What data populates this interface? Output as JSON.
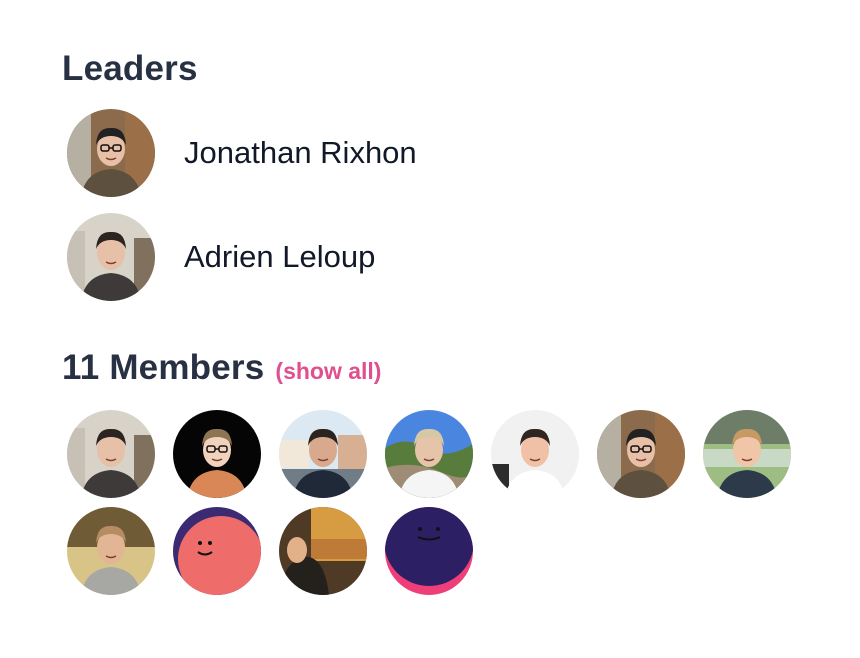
{
  "leaders": {
    "title": "Leaders",
    "people": [
      {
        "name": "Jonathan Rixhon",
        "avatar": "photo-glasses-brick"
      },
      {
        "name": "Adrien Leloup",
        "avatar": "photo-street"
      }
    ]
  },
  "members": {
    "title": "11 Members",
    "show_all_label": "(show all)",
    "avatars": [
      "photo-street",
      "photo-orange-hoodie",
      "photo-harbor",
      "photo-hills",
      "photo-smile-white",
      "photo-glasses-brick",
      "photo-river-tshirt",
      "photo-gray-tshirt",
      "illustration-coral-face",
      "photo-warm-room",
      "illustration-navy-face"
    ]
  },
  "colors": {
    "heading": "#283143",
    "link": "#e04f8f",
    "coral": "#ee6d6a",
    "navy": "#2d1f63"
  }
}
